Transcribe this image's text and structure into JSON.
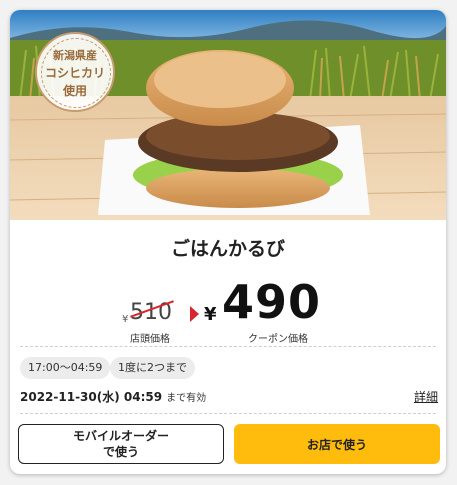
{
  "badge": {
    "line1": "新潟県産",
    "line2": "コシヒカリ",
    "line3": "使用"
  },
  "product": {
    "name": "ごはんかるび"
  },
  "price": {
    "currency_symbol": "¥",
    "original": "510",
    "original_label": "店頭価格",
    "coupon": "490",
    "coupon_label": "クーポン価格"
  },
  "conditions": {
    "time": "17:00〜04:59",
    "limit": "1度に2つまで"
  },
  "expiry": {
    "date": "2022-11-30(水) 04:59",
    "suffix": "まで有効"
  },
  "links": {
    "detail": "詳細"
  },
  "buttons": {
    "mobile_order": "モバイルオーダー\nで使う",
    "use_in_store": "お店で使う"
  },
  "colors": {
    "accent": "#d8262d",
    "primary_button": "#ffbc0d"
  }
}
